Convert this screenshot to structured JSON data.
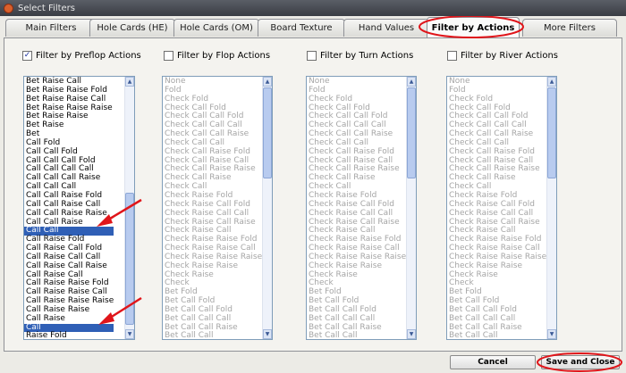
{
  "window": {
    "title": "Select Filters"
  },
  "tabs": [
    {
      "label": "Main Filters"
    },
    {
      "label": "Hole Cards (HE)"
    },
    {
      "label": "Hole Cards (OM)"
    },
    {
      "label": "Board Texture"
    },
    {
      "label": "Hand Values"
    },
    {
      "label": "Filter by Actions"
    },
    {
      "label": "More Filters"
    }
  ],
  "active_tab": "Filter by Actions",
  "columns": {
    "preflop": {
      "label": "Filter by Preflop Actions",
      "checked": true,
      "check_mark": "✓",
      "items": [
        "Bet Raise Call",
        "Bet Raise Raise Fold",
        "Bet Raise Raise Call",
        "Bet Raise Raise Raise",
        "Bet Raise Raise",
        "Bet Raise",
        "Bet",
        "Call Fold",
        "Call Call Fold",
        "Call Call Call Fold",
        "Call Call Call Call",
        "Call Call Call Raise",
        "Call Call Call",
        "Call Call Raise Fold",
        "Call Call Raise Call",
        "Call Call Raise Raise",
        "Call Call Raise",
        "Call Call",
        "Call Raise Fold",
        "Call Raise Call Fold",
        "Call Raise Call Call",
        "Call Raise Call Raise",
        "Call Raise Call",
        "Call Raise Raise Fold",
        "Call Raise Raise Call",
        "Call Raise Raise Raise",
        "Call Raise Raise",
        "Call Raise",
        "Call",
        "Raise Fold"
      ],
      "selected": [
        "Call Call",
        "Call"
      ]
    },
    "flop": {
      "label": "Filter by Flop Actions",
      "checked": false,
      "items": [
        "None",
        "Fold",
        "Check Fold",
        "Check Call Fold",
        "Check Call Call Fold",
        "Check Call Call Call",
        "Check Call Call Raise",
        "Check Call Call",
        "Check Call Raise Fold",
        "Check Call Raise Call",
        "Check Call Raise Raise",
        "Check Call Raise",
        "Check Call",
        "Check Raise Fold",
        "Check Raise Call Fold",
        "Check Raise Call Call",
        "Check Raise Call Raise",
        "Check Raise Call",
        "Check Raise Raise Fold",
        "Check Raise Raise Call",
        "Check Raise Raise Raise",
        "Check Raise Raise",
        "Check Raise",
        "Check",
        "Bet Fold",
        "Bet Call Fold",
        "Bet Call Call Fold",
        "Bet Call Call Call",
        "Bet Call Call Raise",
        "Bet Call Call"
      ]
    },
    "turn": {
      "label": "Filter by Turn Actions",
      "checked": false,
      "items": [
        "None",
        "Fold",
        "Check Fold",
        "Check Call Fold",
        "Check Call Call Fold",
        "Check Call Call Call",
        "Check Call Call Raise",
        "Check Call Call",
        "Check Call Raise Fold",
        "Check Call Raise Call",
        "Check Call Raise Raise",
        "Check Call Raise",
        "Check Call",
        "Check Raise Fold",
        "Check Raise Call Fold",
        "Check Raise Call Call",
        "Check Raise Call Raise",
        "Check Raise Call",
        "Check Raise Raise Fold",
        "Check Raise Raise Call",
        "Check Raise Raise Raise",
        "Check Raise Raise",
        "Check Raise",
        "Check",
        "Bet Fold",
        "Bet Call Fold",
        "Bet Call Call Fold",
        "Bet Call Call Call",
        "Bet Call Call Raise",
        "Bet Call Call"
      ]
    },
    "river": {
      "label": "Filter by River Actions",
      "checked": false,
      "items": [
        "None",
        "Fold",
        "Check Fold",
        "Check Call Fold",
        "Check Call Call Fold",
        "Check Call Call Call",
        "Check Call Call Raise",
        "Check Call Call",
        "Check Call Raise Fold",
        "Check Call Raise Call",
        "Check Call Raise Raise",
        "Check Call Raise",
        "Check Call",
        "Check Raise Fold",
        "Check Raise Call Fold",
        "Check Raise Call Call",
        "Check Raise Call Raise",
        "Check Raise Call",
        "Check Raise Raise Fold",
        "Check Raise Raise Call",
        "Check Raise Raise Raise",
        "Check Raise Raise",
        "Check Raise",
        "Check",
        "Bet Fold",
        "Bet Call Fold",
        "Bet Call Call Fold",
        "Bet Call Call Call",
        "Bet Call Call Raise",
        "Bet Call Call"
      ]
    }
  },
  "buttons": {
    "cancel": "Cancel",
    "save_close": "Save and Close"
  },
  "icons": {
    "scroll_up": "▲",
    "scroll_down": "▼"
  },
  "colors": {
    "selection": "#2f5fb6",
    "annotation": "#e0151a",
    "disabled_text": "#a5a5a5"
  }
}
